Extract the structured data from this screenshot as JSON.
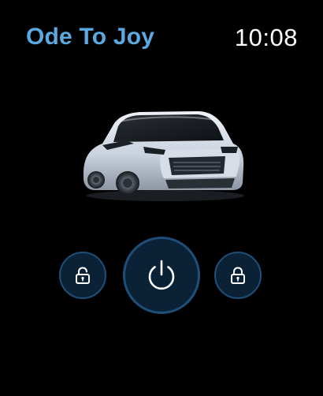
{
  "header": {
    "app_title": "Ode To Joy",
    "time": "10:08"
  },
  "vehicle": {
    "image": "electric-suv-image"
  },
  "controls": {
    "lock_left": {
      "icon": "unlock-icon"
    },
    "start": {
      "icon": "power-icon"
    },
    "lock_right": {
      "icon": "lock-icon"
    }
  },
  "colors": {
    "background": "#000000",
    "accent": "#5aa9e0",
    "button_fill": "#0b2236",
    "button_ring": "#1e4f78",
    "icon": "#ffffff"
  }
}
